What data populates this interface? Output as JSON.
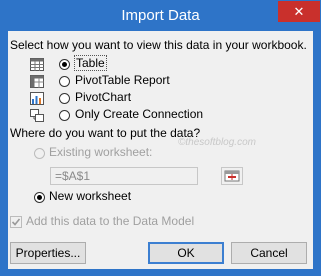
{
  "window": {
    "title": "Import Data",
    "close_glyph": "✕"
  },
  "view_section": {
    "prompt": "Select how you want to view this data in your workbook.",
    "options": [
      {
        "label": "Table",
        "icon": "table-icon",
        "checked": true
      },
      {
        "label": "PivotTable Report",
        "icon": "pivottable-icon",
        "checked": false
      },
      {
        "label": "PivotChart",
        "icon": "pivotchart-icon",
        "checked": false
      },
      {
        "label": "Only Create Connection",
        "icon": "connection-icon",
        "checked": false
      }
    ]
  },
  "placement_section": {
    "prompt": "Where do you want to put the data?",
    "existing_label": "Existing worksheet:",
    "existing_value": "=$A$1",
    "new_label": "New worksheet"
  },
  "watermark": "©thesoftblog.com",
  "model_checkbox": {
    "label": "Add this data to the Data Model",
    "checked": true
  },
  "buttons": {
    "properties": "Properties...",
    "ok": "OK",
    "cancel": "Cancel"
  }
}
